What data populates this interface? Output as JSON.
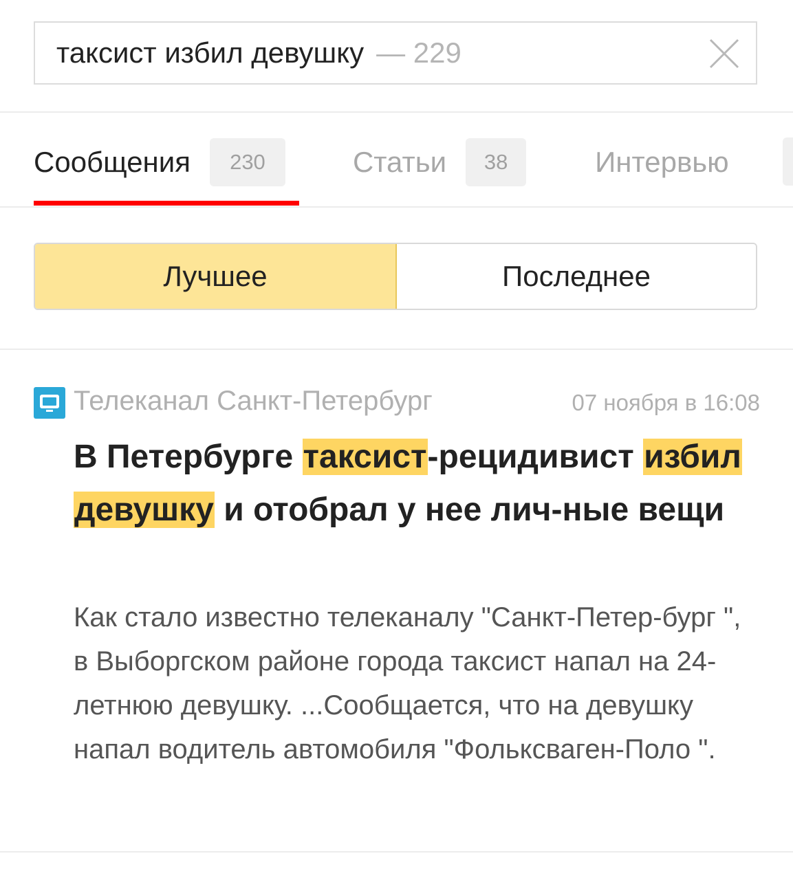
{
  "search": {
    "query": "таксист избил девушку",
    "result_count": "— 229",
    "clear_icon": "close-icon"
  },
  "tabs": [
    {
      "label": "Сообщения",
      "count": "230",
      "active": true
    },
    {
      "label": "Статьи",
      "count": "38",
      "active": false
    },
    {
      "label": "Интервью",
      "count": "",
      "active": false
    }
  ],
  "sort": {
    "best_label": "Лучшее",
    "latest_label": "Последнее",
    "selected": "best"
  },
  "article": {
    "source_icon": "tv-channel-icon",
    "source_name": "Телеканал Санкт-Петербург",
    "timestamp": "07 ноября в 16:08",
    "headline": {
      "part1": "В Петербурге ",
      "hl1": "таксист",
      "part2": "-рецидивист ",
      "hl2": "избил",
      "space": " ",
      "hl3": "девушку",
      "part3": " и отобрал у нее лич-ные вещи"
    },
    "snippet": "Как стало известно телеканалу \"Санкт-Петер-бург \", в Выборгском районе города таксист напал на 24-летнюю девушку. ...Сообщается, что на девушку напал водитель автомобиля \"Фольксваген-Поло \"."
  },
  "colors": {
    "tab_underline": "#ff0000",
    "segment_active": "#fde597",
    "highlight": "#fed562",
    "source_icon": "#2aa8d8"
  }
}
